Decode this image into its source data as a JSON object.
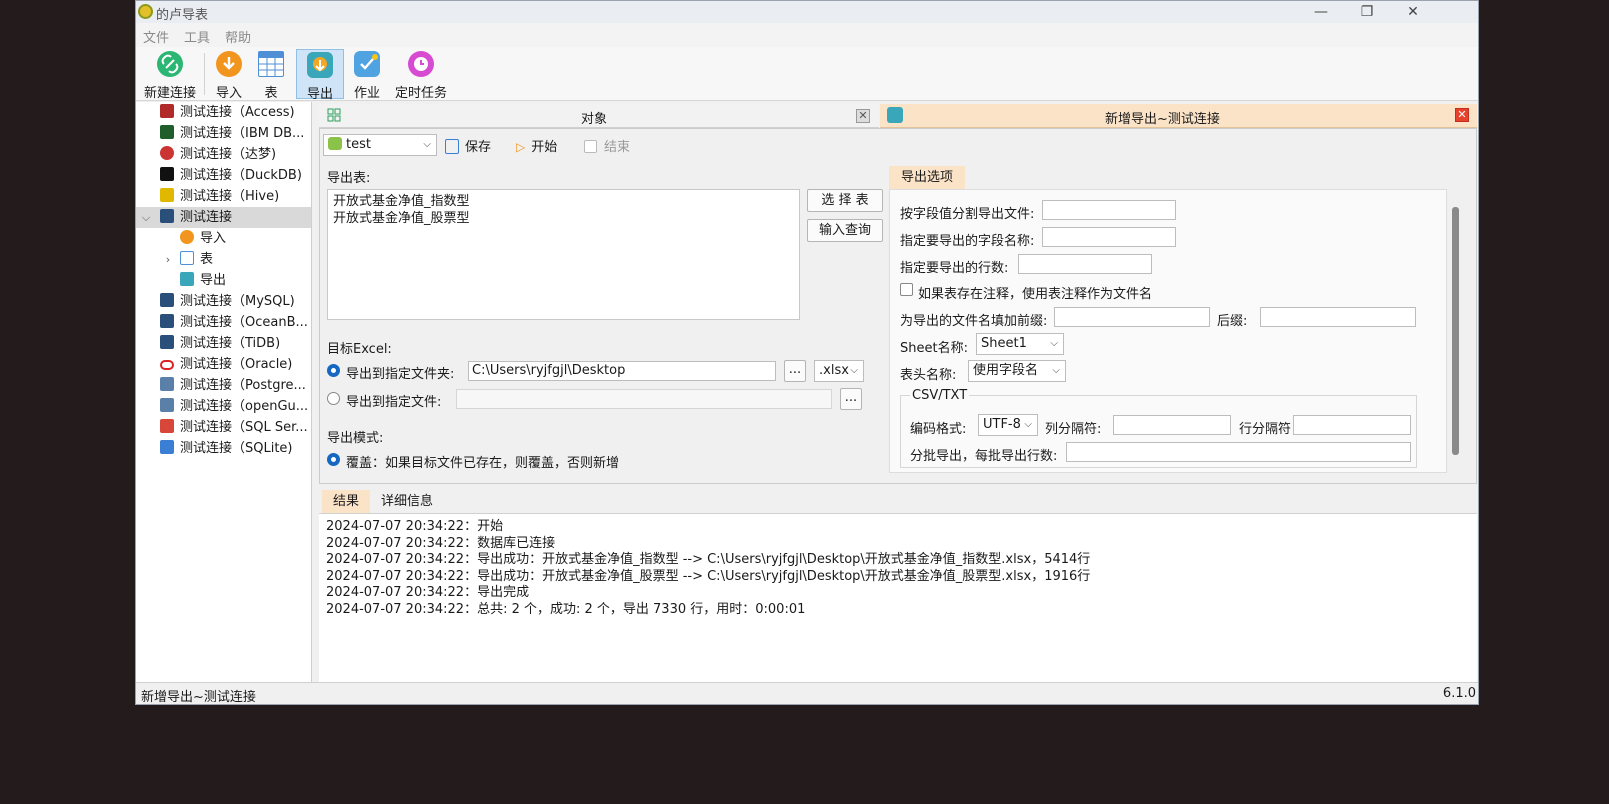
{
  "window": {
    "title": "的卢导表",
    "minimize": "—",
    "maximize": "❐",
    "close": "✕"
  },
  "menu": [
    "文件",
    "工具",
    "帮助"
  ],
  "toolbar": {
    "new_connection": "新建连接",
    "import": "导入",
    "table": "表",
    "export": "导出",
    "job": "作业",
    "scheduled": "定时任务"
  },
  "tree": {
    "items": [
      "测试连接（Access)",
      "测试连接（IBM DB...",
      "测试连接（达梦)",
      "测试连接（DuckDB)",
      "测试连接（Hive)",
      "测试连接",
      "导入",
      "表",
      "导出",
      "测试连接（MySQL)",
      "测试连接（OceanB...",
      "测试连接（TiDB)",
      "测试连接（Oracle)",
      "测试连接（Postgre...",
      "测试连接（openGu...",
      "测试连接（SQL Ser...",
      "测试连接（SQLite)"
    ]
  },
  "panels": {
    "objects_title": "对象",
    "export_title": "新增导出~测试连接"
  },
  "actions": {
    "db_select": "test",
    "save": "保存",
    "start": "开始",
    "stop": "结束"
  },
  "export_tables": {
    "label": "导出表:",
    "items": [
      "开放式基金净值_指数型",
      "开放式基金净值_股票型"
    ],
    "select_btn": "选 择 表",
    "query_btn": "输入查询"
  },
  "target": {
    "label": "目标Excel:",
    "to_folder": "导出到指定文件夹:",
    "folder_path": "C:\\Users\\ryjfgjl\\Desktop",
    "browse": "...",
    "ext": ".xlsx",
    "to_file": "导出到指定文件:",
    "file_path": ""
  },
  "mode": {
    "label": "导出模式:",
    "overwrite": "覆盖：如果目标文件已存在，则覆盖，否则新增"
  },
  "options": {
    "tab": "导出选项",
    "split_by_field": "按字段值分割导出文件:",
    "field_names": "指定要导出的字段名称:",
    "row_count": "指定要导出的行数:",
    "use_comment": "如果表存在注释，使用表注释作为文件名",
    "prefix": "为导出的文件名填加前缀:",
    "suffix": "后缀:",
    "sheet_name_label": "Sheet名称:",
    "sheet_name": "Sheet1",
    "header_label": "表头名称:",
    "header_value": "使用字段名",
    "csv_group": "CSV/TXT",
    "encoding_label": "编码格式:",
    "encoding": "UTF-8",
    "col_sep": "列分隔符:",
    "row_sep": "行分隔符",
    "batch": "分批导出，每批导出行数:"
  },
  "results": {
    "tab_results": "结果",
    "tab_details": "详细信息",
    "log": [
      "2024-07-07 20:34:22：开始",
      "2024-07-07 20:34:22：数据库已连接",
      "2024-07-07 20:34:22：导出成功：开放式基金净值_指数型 --> C:\\Users\\ryjfgjl\\Desktop\\开放式基金净值_指数型.xlsx，5414行",
      "2024-07-07 20:34:22：导出成功：开放式基金净值_股票型 --> C:\\Users\\ryjfgjl\\Desktop\\开放式基金净值_股票型.xlsx，1916行",
      "2024-07-07 20:34:22：导出完成",
      "2024-07-07 20:34:22：总共: 2 个，成功: 2 个，导出 7330 行，用时：0:00:01"
    ]
  },
  "status": {
    "left": "新增导出~测试连接",
    "version": "6.1.0"
  }
}
